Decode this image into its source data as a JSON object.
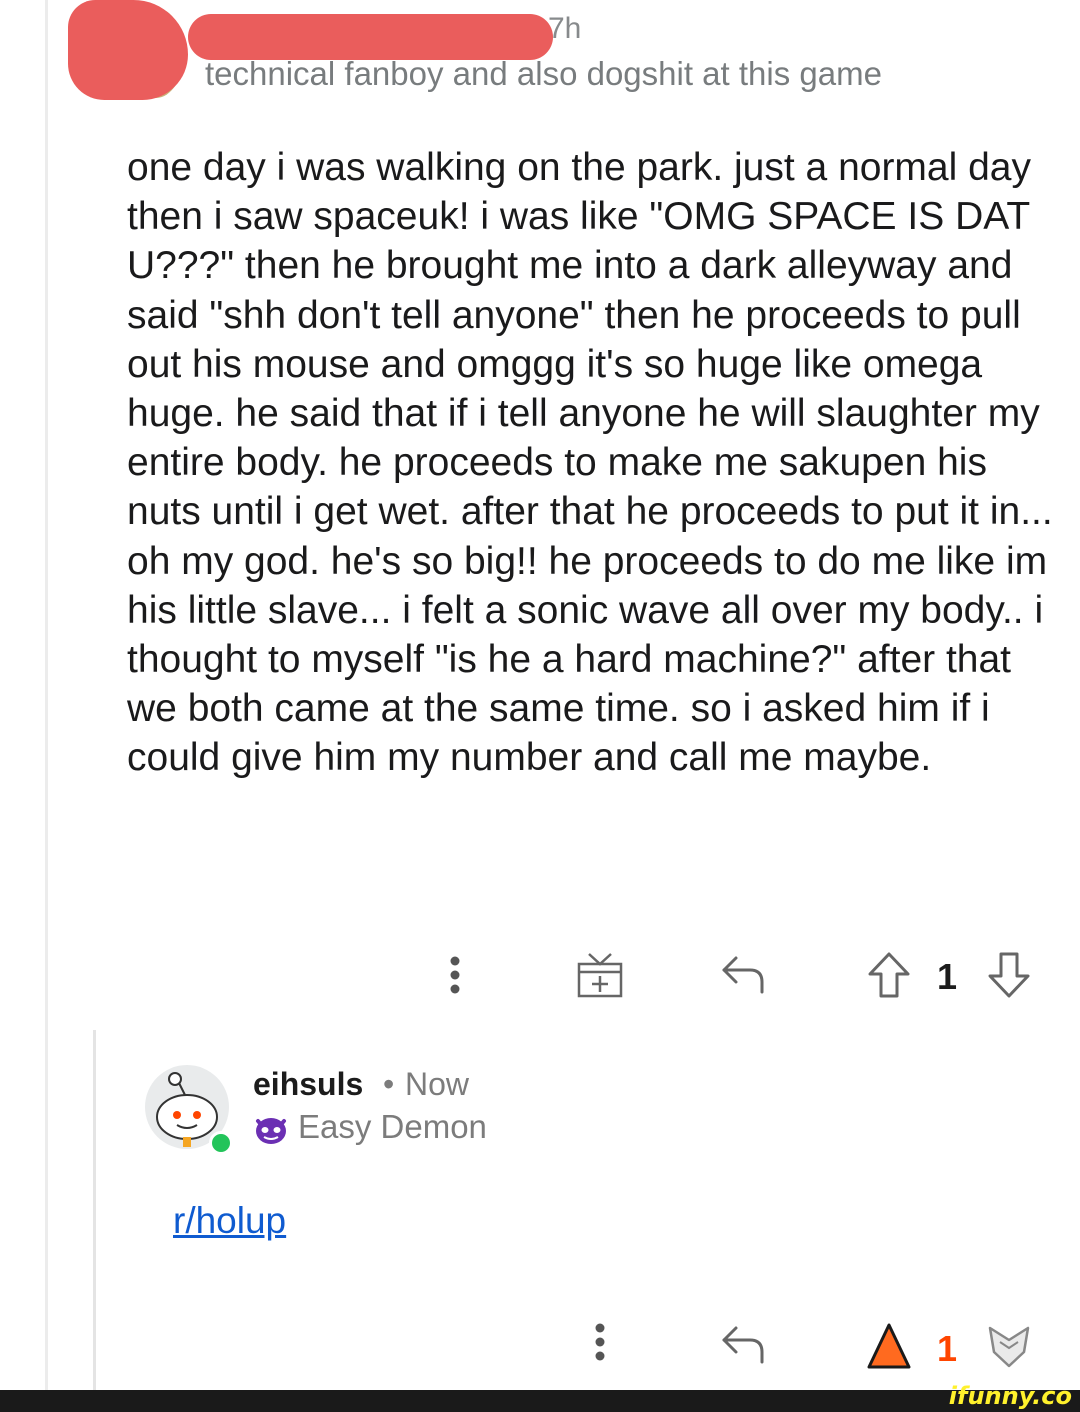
{
  "comment1": {
    "time": "7h",
    "flair": "technical fanboy and also dogshit at this game",
    "body": "one day i was walking on the park. just a normal day then i saw spaceuk! i was like \"OMG SPACE IS DAT U???\" then he brought me into a dark alleyway and said \"shh don't tell anyone\" then he proceeds to pull out his mouse and omggg it's so huge like omega huge. he said that if i tell anyone he will slaughter my entire body. he proceeds to make me sakupen his nuts until i get wet. after that he proceeds to put it in... oh my god. he's so big!! he proceeds to do me like im his little slave... i felt a sonic wave all over my body.. i thought to myself \"is he a hard machine?\" after that we both came at the same time. so i asked him if i could give him my number and call me maybe.",
    "votes": "1",
    "icons": [
      "more-icon",
      "gift-icon",
      "reply-icon",
      "upvote-icon",
      "downvote-icon"
    ]
  },
  "comment2": {
    "username": "eihsuls",
    "separator": "•",
    "time": "Now",
    "flair": "Easy Demon",
    "link": "r/holup",
    "votes": "1",
    "icons": [
      "more-icon",
      "reply-icon",
      "upvote-icon-active",
      "downvote-icon"
    ]
  },
  "watermark": "ifunny.co",
  "colors": {
    "redaction": "#ea5d5c",
    "upvote_active": "#ff4500",
    "link": "#0f5bd0",
    "online": "#23c45a",
    "watermark": "#fff12c"
  }
}
